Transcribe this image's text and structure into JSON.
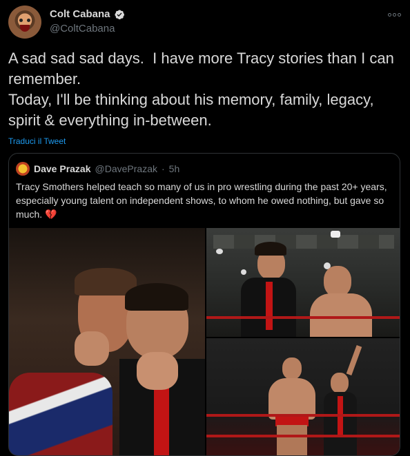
{
  "tweet": {
    "author": {
      "display_name": "Colt Cabana",
      "handle": "@ColtCabana",
      "verified": true
    },
    "text": "A sad sad sad days.  I have more Tracy stories than I can remember.\nToday, I'll be thinking about his memory, family, legacy, spirit & everything in-between.",
    "translate_label": "Traduci il Tweet"
  },
  "quoted_tweet": {
    "author": {
      "display_name": "Dave Prazak",
      "handle": "@DavePrazak",
      "time": "5h"
    },
    "separator": "·",
    "text": "Tracy Smothers helped teach so many of us in pro wrestling during the past 20+ years, especially young talent on independent shows, to whom he owed nothing, but gave so much.",
    "emoji": "💔",
    "media_count": 3
  },
  "icons": {
    "more": "more-icon",
    "verified": "verified-badge-icon"
  },
  "colors": {
    "link": "#1d9bf0",
    "muted": "#6e767d",
    "text": "#d9d9d9",
    "border": "#2f3336",
    "background": "#000000"
  }
}
